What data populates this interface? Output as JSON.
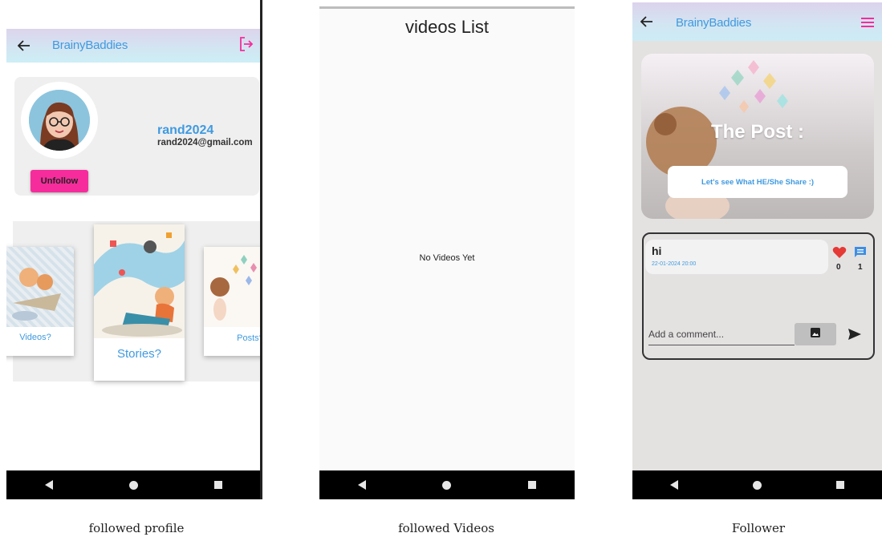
{
  "screen1": {
    "brand": "BrainyBaddies",
    "profile": {
      "username": "rand2024",
      "email": "rand2024@gmail.com",
      "unfollow_label": "Unfollow"
    },
    "carousel": {
      "cards": [
        {
          "label": "Videos?"
        },
        {
          "label": "Stories?"
        },
        {
          "label": "Posts?"
        }
      ]
    }
  },
  "screen2": {
    "title": "videos List",
    "empty_message": "No Videos Yet"
  },
  "screen3": {
    "brand": "BrainyBaddies",
    "post": {
      "title": "The Post :",
      "button_label": "Let's see What HE/She Share :)"
    },
    "comment": {
      "text": "hi",
      "date": "22-01-2024 20:00",
      "likes": "0",
      "replies": "1"
    },
    "input_placeholder": "Add a comment..."
  },
  "captions": {
    "first": "followed profile",
    "second": "followed Videos",
    "third": "Follower"
  },
  "colors": {
    "brand_blue": "#3f9ae0",
    "accent_pink": "#f62c9c",
    "like_red": "#e53935"
  },
  "icons": {
    "back": "arrow-left-icon",
    "logout": "logout-icon",
    "menu": "hamburger-menu-icon",
    "like": "heart-icon",
    "comment": "comment-icon",
    "image": "image-icon",
    "send": "send-icon"
  }
}
